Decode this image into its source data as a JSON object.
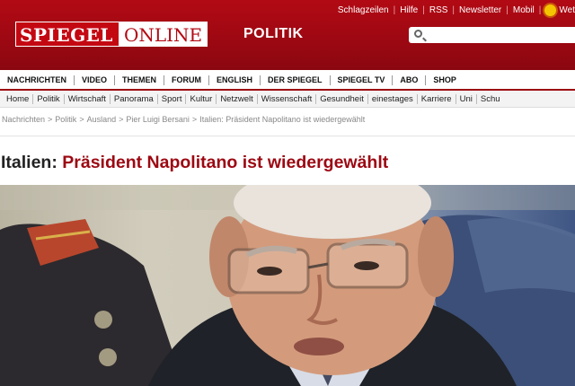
{
  "header": {
    "top_links": [
      "Schlagzeilen",
      "Hilfe",
      "RSS",
      "Newsletter",
      "Mobil",
      "Wet"
    ],
    "logo_spiegel": "SPIEGEL",
    "logo_online": "ONLINE",
    "section": "POLITIK"
  },
  "main_nav": [
    "NACHRICHTEN",
    "VIDEO",
    "THEMEN",
    "FORUM",
    "ENGLISH",
    "DER SPIEGEL",
    "SPIEGEL TV",
    "ABO",
    "SHOP"
  ],
  "sub_nav": [
    "Home",
    "Politik",
    "Wirtschaft",
    "Panorama",
    "Sport",
    "Kultur",
    "Netzwelt",
    "Wissenschaft",
    "Gesundheit",
    "einestages",
    "Karriere",
    "Uni",
    "Schu"
  ],
  "breadcrumb": [
    "Nachrichten",
    "Politik",
    "Ausland",
    "Pier Luigi Bersani",
    "Italien: Präsident Napolitano ist wiedergewählt"
  ],
  "article": {
    "kicker": "Italien:",
    "title": "Präsident Napolitano ist wiedergewählt"
  },
  "colors": {
    "brand_red": "#9c0812",
    "header_red": "#b20a14",
    "weather_sun": "#f5c400"
  }
}
